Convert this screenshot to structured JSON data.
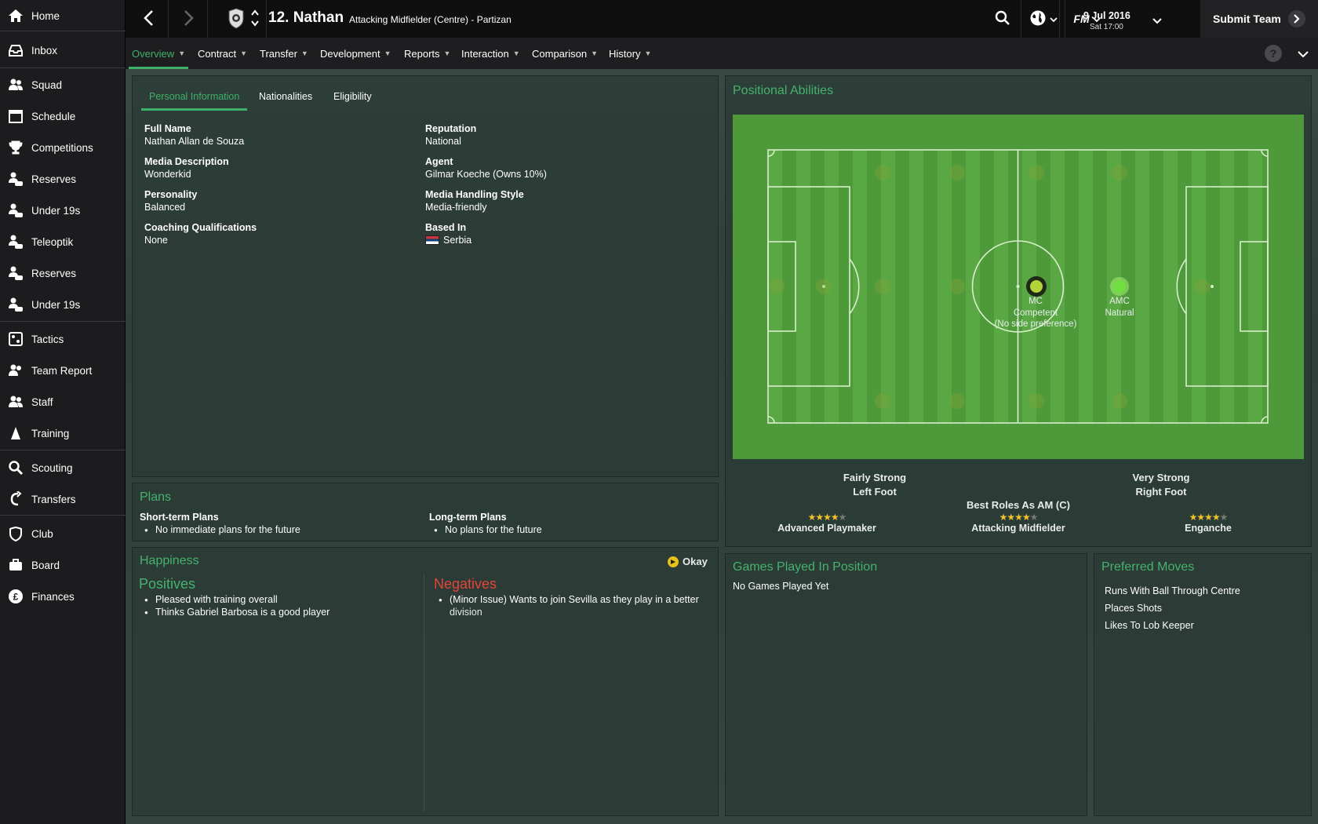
{
  "sidebar": {
    "items": [
      {
        "label": "Home",
        "icon": "home-icon"
      },
      {
        "label": "Inbox",
        "icon": "inbox-icon"
      },
      {
        "label": "Squad",
        "icon": "squad-icon"
      },
      {
        "label": "Schedule",
        "icon": "calendar-icon"
      },
      {
        "label": "Competitions",
        "icon": "trophy-icon"
      },
      {
        "label": "Reserves",
        "icon": "reserves-icon"
      },
      {
        "label": "Under 19s",
        "icon": "under19-icon"
      },
      {
        "label": "Teleoptik",
        "icon": "reserves-icon"
      },
      {
        "label": "Reserves",
        "icon": "reserves-icon"
      },
      {
        "label": "Under 19s",
        "icon": "reserves-icon"
      },
      {
        "label": "Tactics",
        "icon": "tactics-icon"
      },
      {
        "label": "Team Report",
        "icon": "report-icon"
      },
      {
        "label": "Staff",
        "icon": "staff-icon"
      },
      {
        "label": "Training",
        "icon": "training-icon"
      },
      {
        "label": "Scouting",
        "icon": "search-icon"
      },
      {
        "label": "Transfers",
        "icon": "transfers-icon"
      },
      {
        "label": "Club",
        "icon": "shield-icon"
      },
      {
        "label": "Board",
        "icon": "board-icon"
      },
      {
        "label": "Finances",
        "icon": "pound-icon"
      }
    ]
  },
  "header": {
    "player_name": "12. Nathan",
    "player_sub": "Attacking Midfielder (Centre) - Partizan",
    "date_main": "9 Jul 2016",
    "date_sub": "Sat 17:00",
    "submit_label": "Submit Team",
    "fm_label": "FM"
  },
  "tabs": [
    "Overview",
    "Contract",
    "Transfer",
    "Development",
    "Reports",
    "Interaction",
    "Comparison",
    "History"
  ],
  "personal": {
    "subtabs": [
      "Personal Information",
      "Nationalities",
      "Eligibility"
    ],
    "fields": [
      {
        "label": "Full Name",
        "value": "Nathan Allan de Souza"
      },
      {
        "label": "Reputation",
        "value": "National"
      },
      {
        "label": "Media Description",
        "value": "Wonderkid"
      },
      {
        "label": "Agent",
        "value": "Gilmar Koeche (Owns 10%)"
      },
      {
        "label": "Personality",
        "value": "Balanced"
      },
      {
        "label": "Media Handling Style",
        "value": "Media-friendly"
      },
      {
        "label": "Coaching Qualifications",
        "value": "None"
      },
      {
        "label": "Based In",
        "value": "Serbia"
      }
    ]
  },
  "plans": {
    "title": "Plans",
    "short_label": "Short-term Plans",
    "short_value": "No immediate plans for the future",
    "long_label": "Long-term Plans",
    "long_value": "No plans for the future"
  },
  "happiness": {
    "title": "Happiness",
    "status": "Okay",
    "positives_title": "Positives",
    "positives": [
      "Pleased with training overall",
      "Thinks Gabriel Barbosa is a good player"
    ],
    "negatives_title": "Negatives",
    "negatives": [
      "(Minor Issue) Wants to join Sevilla as they play in a better",
      "division"
    ]
  },
  "positional": {
    "title": "Positional Abilities",
    "mc_code": "MC",
    "mc_rating": "Competent",
    "mc_note": "(No side preference)",
    "amc_code": "AMC",
    "amc_rating": "Natural",
    "left_foot_rating": "Fairly Strong",
    "left_foot_label": "Left Foot",
    "right_foot_rating": "Very Strong",
    "right_foot_label": "Right Foot",
    "best_roles_title": "Best Roles As AM (C)",
    "roles": [
      {
        "name": "Advanced Playmaker",
        "stars": 4
      },
      {
        "name": "Attacking Midfielder",
        "stars": 4
      },
      {
        "name": "Enganche",
        "stars": 4
      }
    ]
  },
  "games": {
    "title": "Games Played In Position",
    "value": "No Games Played Yet"
  },
  "moves": {
    "title": "Preferred Moves",
    "items": [
      "Runs With Ball Through Centre",
      "Places Shots",
      "Likes To Lob Keeper"
    ]
  },
  "colors": {
    "accent_green": "#3fb06a",
    "negative_red": "#e0463a",
    "pitch_green": "#4e9a3a",
    "natural_dot": "#6fe040",
    "competent_dot": "#b4d23a"
  }
}
